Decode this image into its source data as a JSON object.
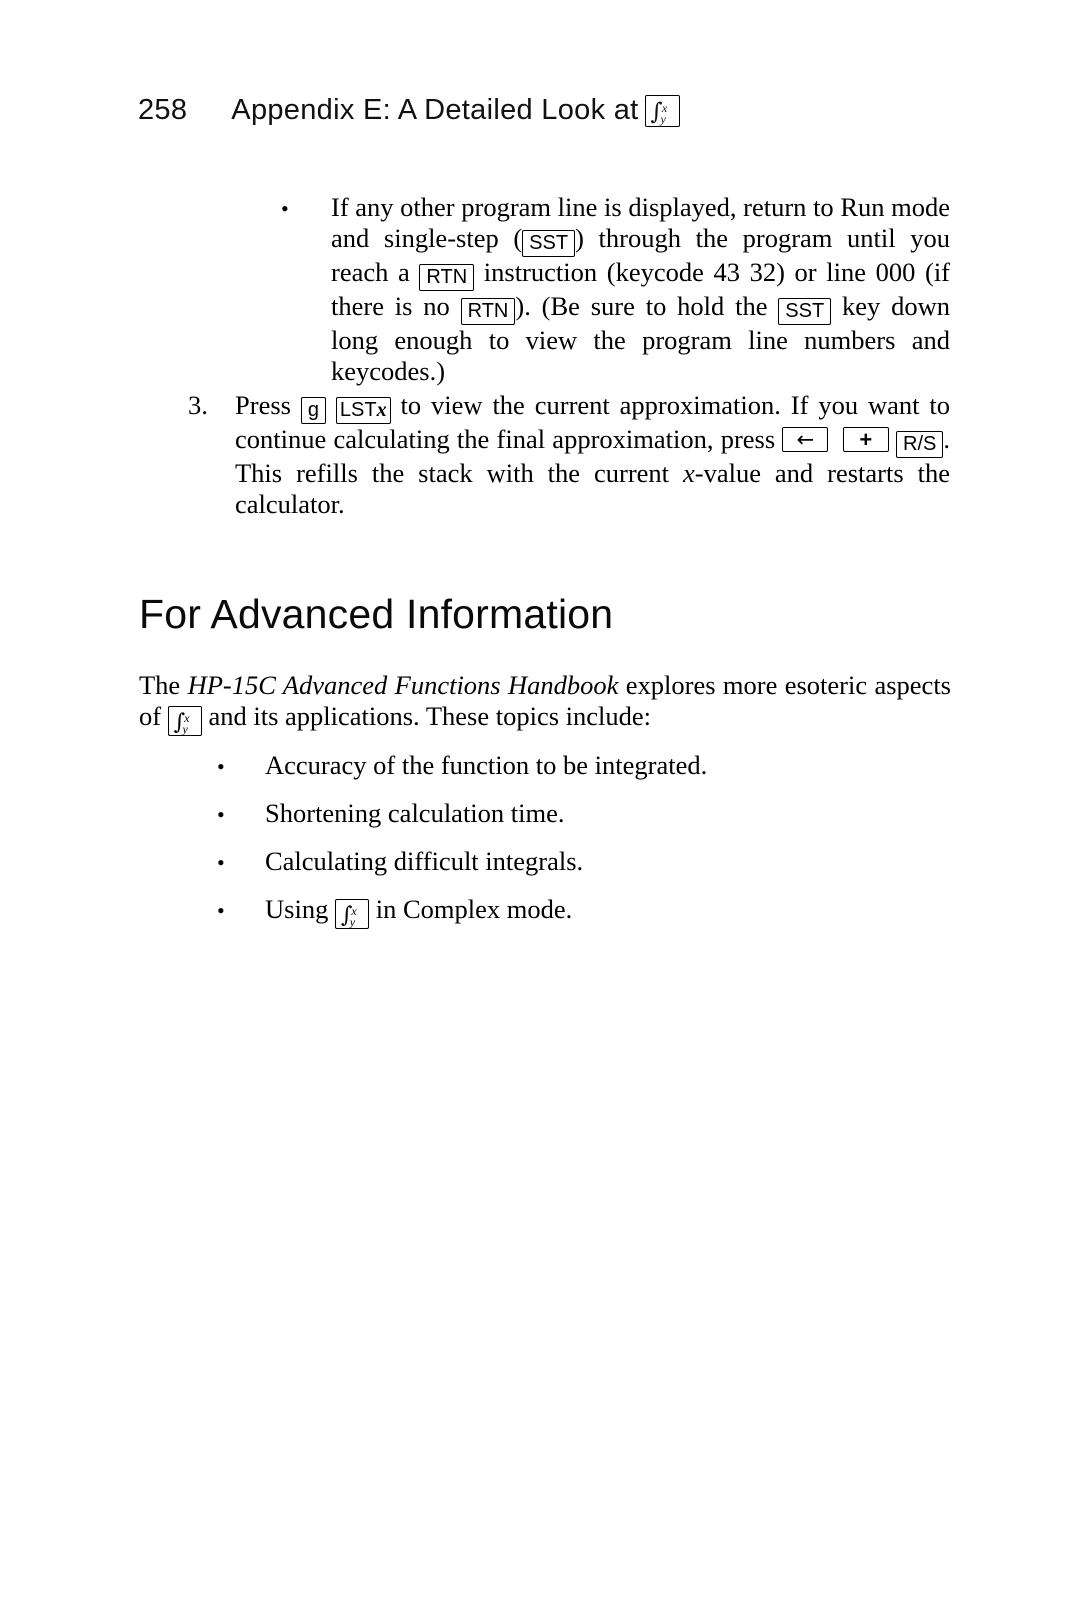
{
  "page": {
    "folio": "258",
    "running_head": "Appendix E: A Detailed Look at",
    "running_head_key": "integral-key"
  },
  "bullet_paragraph": {
    "bullet_glyph": "•",
    "seg_1": "If any other program line is displayed, return to Run mode and single-step (",
    "key_sst_1": "SST",
    "seg_2": ") through the program until you reach a ",
    "key_rtn_1": "RTN",
    "seg_3": " instruction (keycode 43 32) or line 000 (if there is no ",
    "key_rtn_2": "RTN",
    "seg_4": "). (Be sure to hold the ",
    "key_sst_2": "SST",
    "seg_5": " key down long enough to view the program line numbers and keycodes.)"
  },
  "numbered_item": {
    "number": "3.",
    "seg_1": "Press ",
    "key_g": "g",
    "key_lstx_prefix": "LST",
    "key_lstx_var": "x",
    "seg_2": " to view the current approximation. If you want to continue calculating the final approximation, press ",
    "key_backarrow": "←",
    "key_plus": "+",
    "key_rs": "R/S",
    "seg_3": ". This refills the stack with the current ",
    "var_x": "x",
    "seg_4": "-value and restarts the calculator."
  },
  "section": {
    "heading": "For Advanced Information",
    "intro_seg_1": "The ",
    "intro_title_italic": "HP-15C Advanced Functions Handbook",
    "intro_seg_2": " explores more esoteric aspects of ",
    "intro_key": "integral-key",
    "intro_seg_3": " and its applications. These topics include:"
  },
  "topics": {
    "bullet_glyph": "•",
    "items": [
      {
        "text": "Accuracy of the function to be integrated."
      },
      {
        "text": "Shortening calculation time."
      },
      {
        "text": "Calculating difficult integrals."
      },
      {
        "prefix": "Using ",
        "key": "integral-key",
        "suffix": " in Complex mode."
      }
    ]
  },
  "key_glyphs": {
    "integral_symbol": "∫",
    "integral_sup": "x",
    "integral_sub": "y"
  }
}
